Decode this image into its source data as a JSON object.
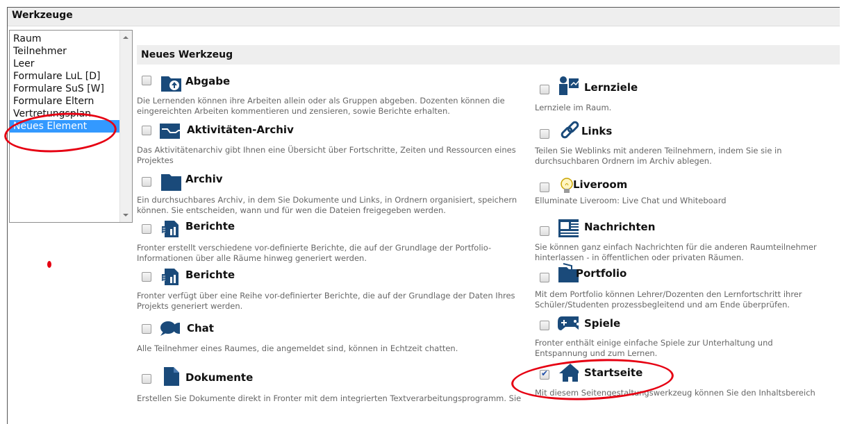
{
  "header": {
    "title": "Werkzeuge"
  },
  "list": {
    "items": [
      {
        "label": "Raum"
      },
      {
        "label": "Teilnehmer"
      },
      {
        "label": "Leer"
      },
      {
        "label": "Formulare LuL  [D]"
      },
      {
        "label": "Formulare SuS  [W]"
      },
      {
        "label": "Formulare Eltern"
      },
      {
        "label": "Vertretungsplan"
      },
      {
        "label": "Neues Element",
        "selected": true
      }
    ]
  },
  "section": {
    "title": "Neues Werkzeug"
  },
  "tools_left": [
    {
      "name": "Abgabe",
      "icon": "upload-folder-icon",
      "desc": "Die Lernenden können ihre Arbeiten allein oder als Gruppen abgeben. Dozenten können die eingereichten Arbeiten kommentieren und zensieren, sowie Berichte erhalten."
    },
    {
      "name": "Aktivitäten-Archiv",
      "icon": "activity-chart-icon",
      "desc": "Das Aktivitätenarchiv gibt Ihnen eine Übersicht über Fortschritte, Zeiten und Ressourcen eines Projektes"
    },
    {
      "name": "Archiv",
      "icon": "folder-icon",
      "desc": "Ein durchsuchbares Archiv, in dem Sie Dokumente und Links, in Ordnern organisiert, speichern können. Sie entscheiden, wann und für wen die Dateien freigegeben werden."
    },
    {
      "name": "Berichte",
      "icon": "report-icon",
      "desc": "Fronter erstellt verschiedene vor-definierte Berichte, die auf der Grundlage der Portfolio-Informationen über alle Räume hinweg generiert werden."
    },
    {
      "name": "Berichte",
      "icon": "report-icon",
      "desc": "Fronter verfügt über eine Reihe vor-definierter Berichte, die auf der Grundlage der Daten Ihres Projekts generiert werden."
    },
    {
      "name": "Chat",
      "icon": "chat-bubbles-icon",
      "desc": "Alle Teilnehmer eines Raumes, die angemeldet sind, können in Echtzeit chatten."
    },
    {
      "name": "Dokumente",
      "icon": "document-icon",
      "desc": "Erstellen Sie Dokumente direkt in Fronter mit dem integrierten Textverarbeitungsprogramm. Sie"
    }
  ],
  "tools_right": [
    {
      "name": "Lernziele",
      "icon": "learning-goals-icon",
      "desc": "Lernziele im Raum."
    },
    {
      "name": "Links",
      "icon": "chain-link-icon",
      "desc": "Teilen Sie Weblinks mit anderen Teilnehmern, indem Sie sie in durchsuchbaren Ordnern im Archiv ablegen."
    },
    {
      "name": "Liveroom",
      "icon": "lightbulb-icon",
      "desc": "Elluminate Liveroom: Live Chat und Whiteboard"
    },
    {
      "name": "Nachrichten",
      "icon": "message-board-icon",
      "desc": "Sie können ganz einfach Nachrichten für die anderen Raumteilnehmer hinterlassen - in öffentlichen oder privaten Räumen."
    },
    {
      "name": "Portfolio",
      "icon": "portfolio-folder-icon",
      "desc": "Mit dem Portfolio können Lehrer/Dozenten den Lernfortschritt ihrer Schüler/Studenten prozessbegleitend und am Ende überprüfen."
    },
    {
      "name": "Spiele",
      "icon": "gamepad-icon",
      "desc": "Fronter enthält einige einfache Spiele zur Unterhaltung und Entspannung und zum Lernen."
    },
    {
      "name": "Startseite",
      "icon": "home-icon",
      "checked": true,
      "desc": "Mit diesem Seitengestaltungswerkzeug können Sie den Inhaltsbereich"
    }
  ]
}
